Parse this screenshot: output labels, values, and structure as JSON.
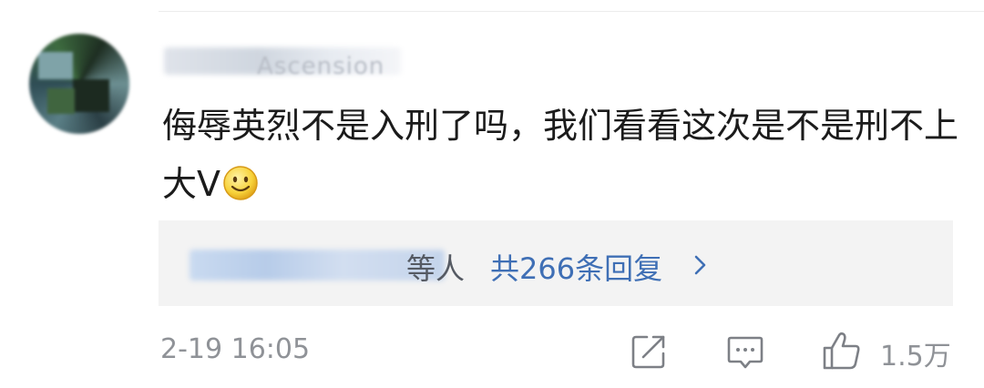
{
  "comment": {
    "username": "Ascension",
    "content": "侮辱英烈不是入刑了吗，我们看看这次是不是刑不上大V",
    "emoji": "smiley-emoji",
    "replies": {
      "names_suffix": "等人",
      "count_label": "共266条回复"
    },
    "timestamp": "2-19 16:05",
    "likes": "1.5万"
  },
  "colors": {
    "link": "#3f6fb5",
    "text": "#1b1b1b",
    "meta": "#8f9297",
    "reply_bg": "#f3f3f3"
  },
  "icons": [
    "share-icon",
    "comment-icon",
    "like-icon",
    "chevron-right-icon"
  ]
}
